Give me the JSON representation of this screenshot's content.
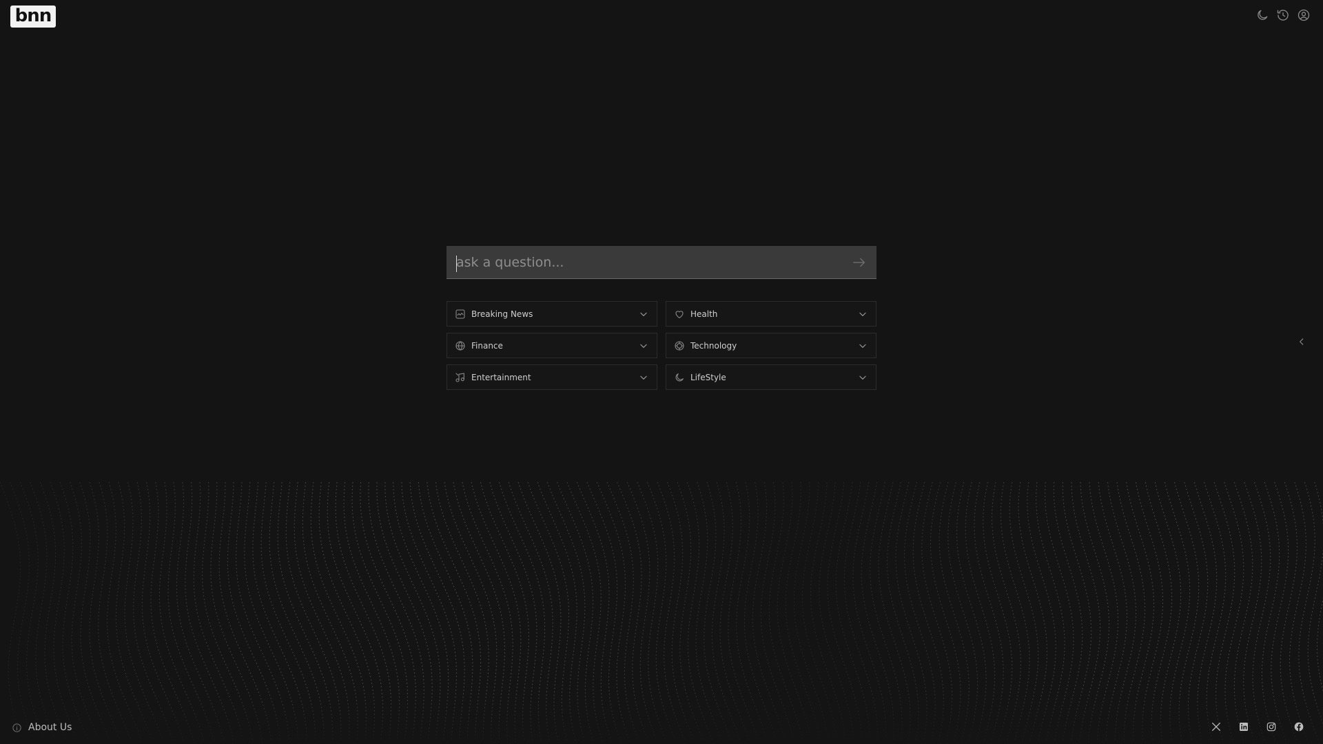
{
  "header": {
    "logo_text": "bnn",
    "icons": [
      "moon-icon",
      "history-icon",
      "user-icon"
    ]
  },
  "search": {
    "placeholder": "ask a question...",
    "value": "",
    "submit_icon": "arrow-right-icon"
  },
  "categories": [
    {
      "label": "Breaking News",
      "icon": "chart-line-icon"
    },
    {
      "label": "Health",
      "icon": "heart-icon"
    },
    {
      "label": "Finance",
      "icon": "globe-icon"
    },
    {
      "label": "Technology",
      "icon": "chip-icon"
    },
    {
      "label": "Entertainment",
      "icon": "music-icon"
    },
    {
      "label": "LifeStyle",
      "icon": "moon-icon"
    }
  ],
  "footer": {
    "about_label": "About Us",
    "socials": [
      "x-icon",
      "linkedin-icon",
      "instagram-icon",
      "facebook-icon"
    ]
  },
  "colors": {
    "background": "#141414",
    "search_bg": "#3a3a3a",
    "card_border": "#2c2c2c",
    "text": "#cfcfcf"
  }
}
